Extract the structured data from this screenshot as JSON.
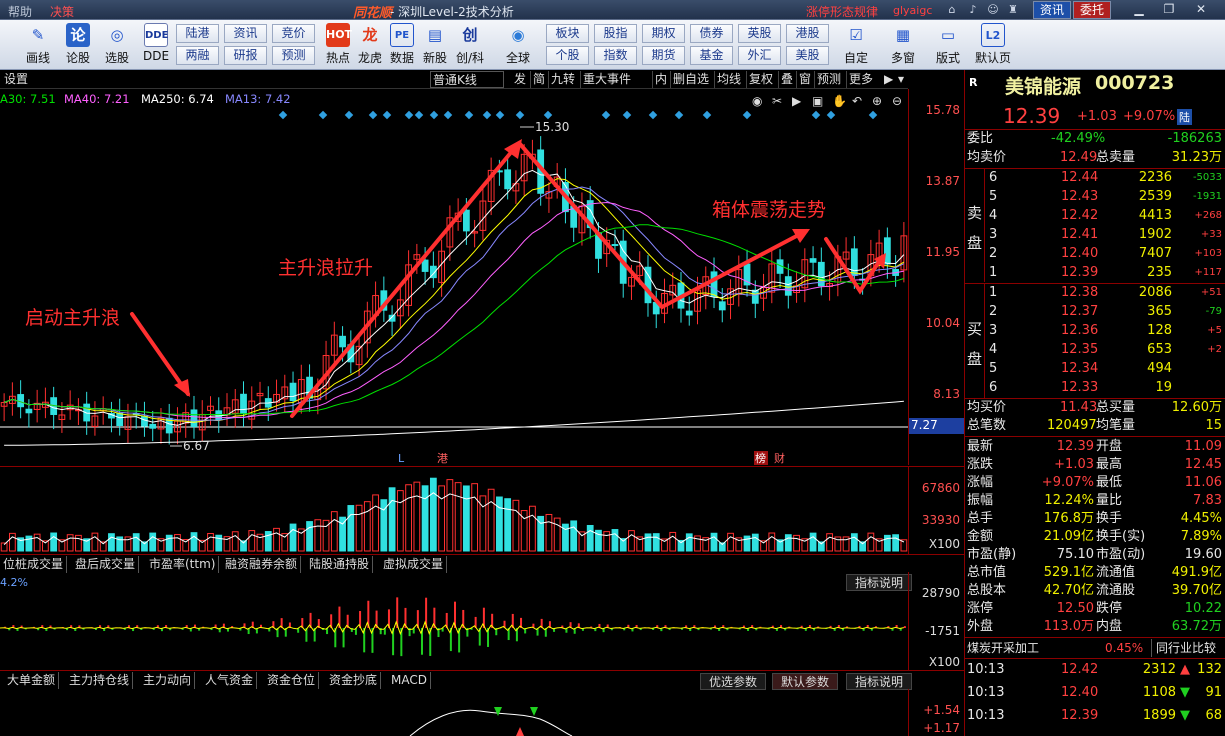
{
  "titlebar": {
    "menu_help": "帮助",
    "menu_decision": "决策",
    "logo": "同花顺",
    "window_title": "- 深圳Level-2技术分析",
    "link_text": "涨停形态规律",
    "user": "glyaigc",
    "btn_news": "资讯",
    "btn_order": "委托"
  },
  "toolbar": {
    "big": [
      {
        "label": "画线",
        "icon": "pencil-icon"
      },
      {
        "label": "论股",
        "icon": "discuss-icon"
      },
      {
        "label": "选股",
        "icon": "pick-stock-icon"
      },
      {
        "label": "DDE",
        "icon": "dde-icon"
      }
    ],
    "small_top": [
      "陆港",
      "资讯",
      "竞价",
      "板块",
      "股指",
      "期权",
      "债券",
      "英股",
      "港股"
    ],
    "small_bottom": [
      "两融",
      "研报",
      "预测",
      "个股",
      "指数",
      "期货",
      "基金",
      "外汇",
      "美股"
    ],
    "big2": [
      {
        "label": "热点",
        "icon": "hot-icon"
      },
      {
        "label": "龙虎",
        "icon": "dragon-tiger-icon"
      },
      {
        "label": "数据",
        "icon": "data-icon"
      },
      {
        "label": "新股",
        "icon": "new-stock-icon"
      },
      {
        "label": "创/科",
        "icon": "chuang-ke-icon"
      },
      {
        "label": "全球",
        "icon": "globe-icon"
      },
      {
        "label": "自定",
        "icon": "custom-icon"
      },
      {
        "label": "多窗",
        "icon": "multi-window-icon"
      },
      {
        "label": "版式",
        "icon": "layout-icon"
      },
      {
        "label": "默认页",
        "icon": "default-page-icon"
      }
    ]
  },
  "chartbar": {
    "settings": "设置",
    "kline": "普通K线",
    "items": [
      "发",
      "简",
      "九转",
      "重大事件",
      "内",
      "删自选",
      "均线",
      "复权",
      "叠",
      "窗",
      "预测",
      "更多"
    ]
  },
  "ma_legend": [
    {
      "text": "A30: 7.51",
      "color": "#00e000"
    },
    {
      "text": "MA40: 7.21",
      "color": "#ff60ff"
    },
    {
      "text": "MA250: 6.74",
      "color": "#ffffff"
    },
    {
      "text": "MA13: 7.42",
      "color": "#8888ff"
    }
  ],
  "price_axis": [
    "15.78",
    "13.87",
    "11.95",
    "10.04",
    "8.13",
    "7.27"
  ],
  "high_label": "15.30",
  "low_label": "6.67",
  "marks": {
    "L": "L",
    "gang": "港",
    "bang": "榜",
    "cai": "财"
  },
  "annotations": {
    "a1": "启动主升浪",
    "a2": "主升浪拉升",
    "a3": "箱体震荡走势"
  },
  "vol_axis": [
    "67860",
    "33930",
    "X100"
  ],
  "tabs1": [
    "位桩成交量",
    "盘后成交量",
    "市盈率(ttm)",
    "融资融券余额",
    "陆股通持股",
    "虚拟成交量"
  ],
  "ind1_label": "指标说明",
  "ind1_pct": "4.2%",
  "ind1_axis": [
    "28790",
    "-1751",
    "X100"
  ],
  "tabs2": [
    "大单金额",
    "主力持仓线",
    "主力动向",
    "人气资金",
    "资金仓位",
    "资金抄底",
    "MACD"
  ],
  "tabs2_btns": [
    "优选参数",
    "默认参数",
    "指标说明"
  ],
  "ind2_axis": [
    "+1.54",
    "+1.17"
  ],
  "quote": {
    "name": "美锦能源",
    "code": "000723",
    "price": "12.39",
    "change": "+1.03",
    "pct": "+9.07%",
    "tag": "陆",
    "weibi_label": "委比",
    "weibi": "-42.49%",
    "weicha": "-186263",
    "avg_sell_label": "均卖价",
    "avg_sell": "12.49",
    "total_sell_label": "总卖量",
    "total_sell": "31.23万",
    "sell": [
      [
        "6",
        "12.44",
        "2236",
        "-5033"
      ],
      [
        "5",
        "12.43",
        "2539",
        "-1931"
      ],
      [
        "4",
        "12.42",
        "4413",
        "+268"
      ],
      [
        "3",
        "12.41",
        "1902",
        "+33"
      ],
      [
        "2",
        "12.40",
        "7407",
        "+103"
      ],
      [
        "1",
        "12.39",
        "235",
        "+117"
      ]
    ],
    "buy": [
      [
        "1",
        "12.38",
        "2086",
        "+51"
      ],
      [
        "2",
        "12.37",
        "365",
        "-79"
      ],
      [
        "3",
        "12.36",
        "128",
        "+5"
      ],
      [
        "4",
        "12.35",
        "653",
        "+2"
      ],
      [
        "5",
        "12.34",
        "494",
        ""
      ],
      [
        "6",
        "12.33",
        "19",
        ""
      ]
    ],
    "sell_label": "卖盘",
    "buy_label": "买盘",
    "avg_buy_label": "均买价",
    "avg_buy": "11.43",
    "total_buy_label": "总买量",
    "total_buy": "12.60万",
    "total_deals_label": "总笔数",
    "total_deals": "120497",
    "avg_deal_label": "均笔量",
    "avg_deal": "15",
    "stats": [
      [
        "最新",
        "12.39",
        "red",
        "开盘",
        "11.09",
        "red"
      ],
      [
        "涨跌",
        "+1.03",
        "red",
        "最高",
        "12.45",
        "red"
      ],
      [
        "涨幅",
        "+9.07%",
        "red",
        "最低",
        "11.06",
        "red"
      ],
      [
        "振幅",
        "12.24%",
        "yel",
        "量比",
        "7.83",
        "red"
      ],
      [
        "总手",
        "176.8万",
        "yel",
        "换手",
        "4.45%",
        "yel"
      ],
      [
        "金额",
        "21.09亿",
        "yel",
        "换手(实)",
        "7.89%",
        "yel"
      ],
      [
        "市盈(静)",
        "75.10",
        "wht",
        "市盈(动)",
        "19.60",
        "wht"
      ],
      [
        "总市值",
        "529.1亿",
        "yel",
        "流通值",
        "491.9亿",
        "yel"
      ],
      [
        "总股本",
        "42.70亿",
        "yel",
        "流通股",
        "39.70亿",
        "yel"
      ],
      [
        "涨停",
        "12.50",
        "red",
        "跌停",
        "10.22",
        "grn"
      ],
      [
        "外盘",
        "113.0万",
        "red",
        "内盘",
        "63.72万",
        "grn"
      ]
    ],
    "industry": "煤炭开采加工",
    "industry_pct": "0.45%",
    "compare": "同行业比较",
    "ticks": [
      [
        "10:13",
        "12.42",
        "2312",
        "up",
        "132"
      ],
      [
        "10:13",
        "12.40",
        "1108",
        "down",
        "91"
      ],
      [
        "10:13",
        "12.39",
        "1899",
        "down",
        "68"
      ]
    ]
  },
  "chart_data": {
    "type": "candlestick",
    "ylim": [
      6.67,
      15.78
    ],
    "high": 15.3,
    "low": 6.67,
    "last": 12.39
  }
}
